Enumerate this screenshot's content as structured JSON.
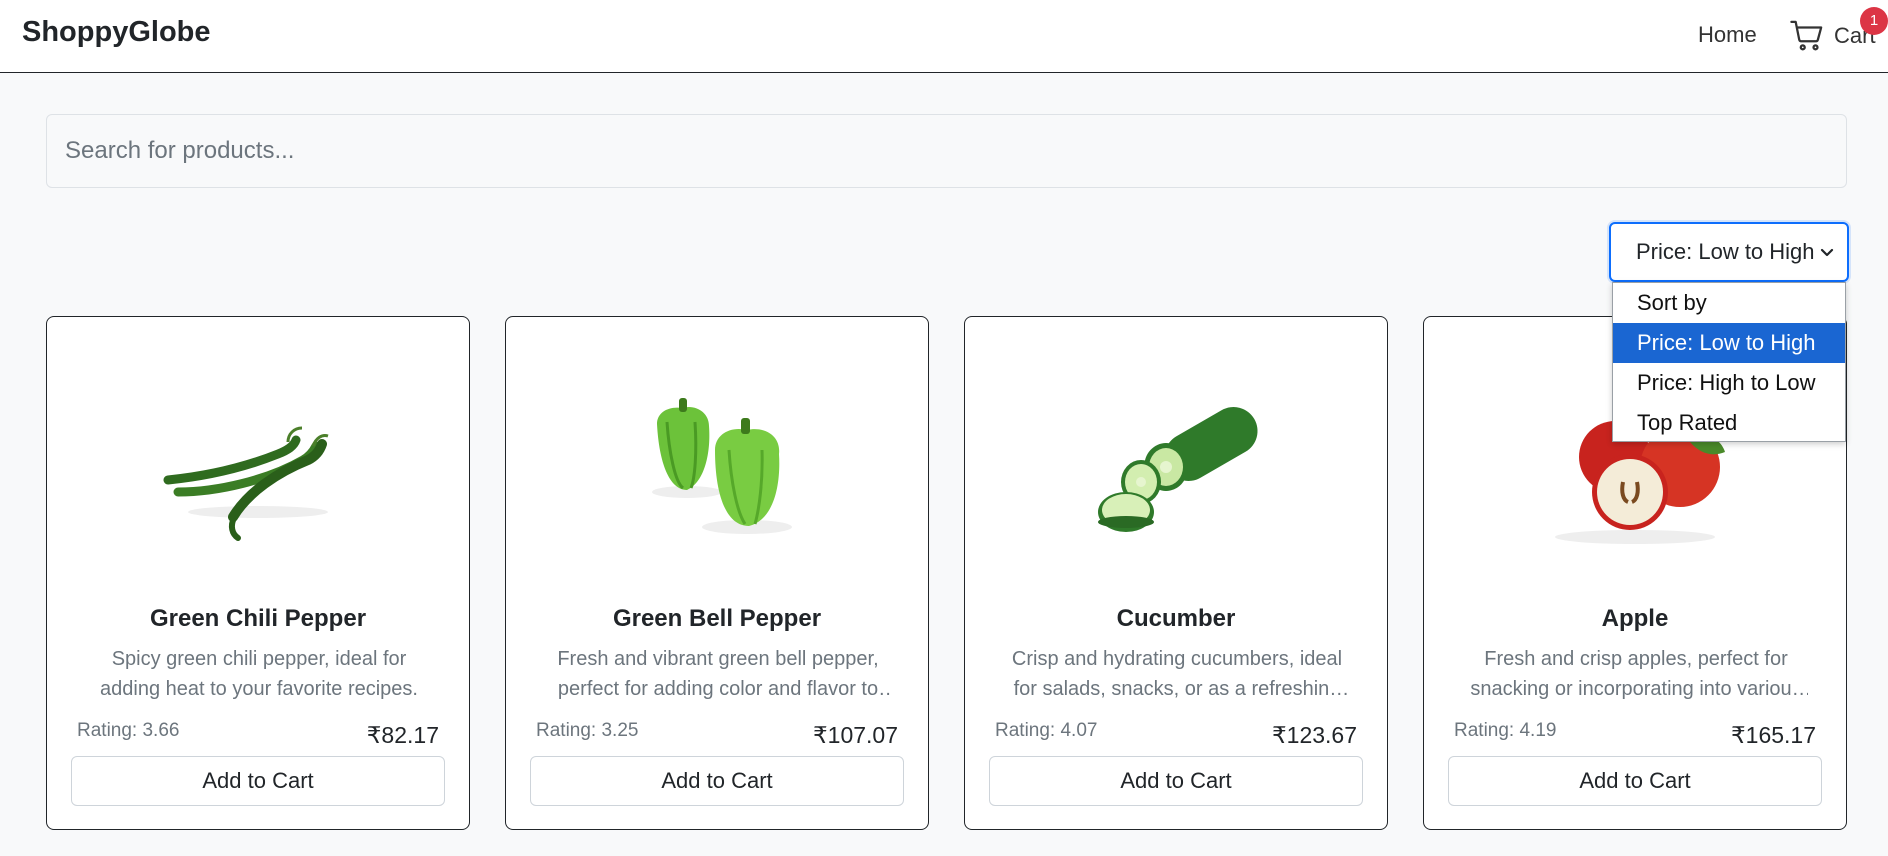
{
  "navbar": {
    "brand": "ShoppyGlobe",
    "home_label": "Home",
    "cart_label": "Cart",
    "cart_count": "1",
    "cart_icon": "shopping-cart-icon"
  },
  "search": {
    "placeholder": "Search for products...",
    "value": ""
  },
  "sort": {
    "selected": "Price: Low to High",
    "options": [
      "Sort by",
      "Price: Low to High",
      "Price: High to Low",
      "Top Rated"
    ],
    "expanded": true
  },
  "products": [
    {
      "title": "Green Chili Pepper",
      "description": "Spicy green chili pepper, ideal for adding heat to your favorite recipes.",
      "rating": "Rating: 3.66",
      "price": "₹82.17",
      "button": "Add to Cart"
    },
    {
      "title": "Green Bell Pepper",
      "description": "Fresh and vibrant green bell pepper, perfect for adding color and flavor to your dishes.",
      "rating": "Rating: 3.25",
      "price": "₹107.07",
      "button": "Add to Cart"
    },
    {
      "title": "Cucumber",
      "description": "Crisp and hydrating cucumbers, ideal for salads, snacks, or as a refreshing addition.",
      "rating": "Rating: 4.07",
      "price": "₹123.67",
      "button": "Add to Cart"
    },
    {
      "title": "Apple",
      "description": "Fresh and crisp apples, perfect for snacking or incorporating into various recipes.",
      "rating": "Rating: 4.19",
      "price": "₹165.17",
      "button": "Add to Cart"
    }
  ],
  "colors": {
    "accent": "#0d6efd",
    "selected_option": "#1a66d2",
    "badge": "#dc3545"
  }
}
